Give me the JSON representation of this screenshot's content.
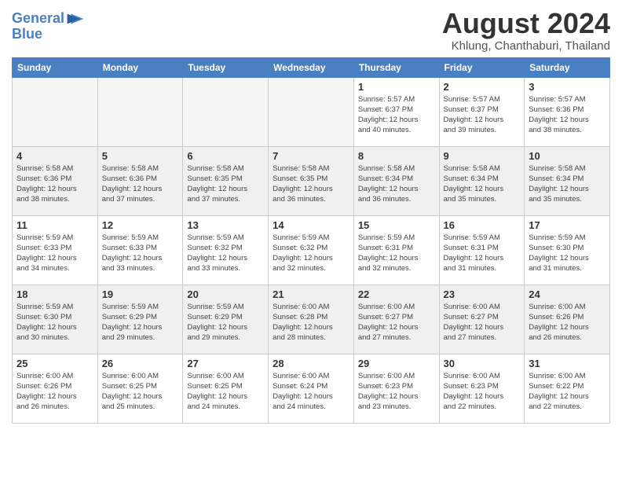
{
  "header": {
    "logo_line1": "General",
    "logo_line2": "Blue",
    "month": "August 2024",
    "location": "Khlung, Chanthaburi, Thailand"
  },
  "days_of_week": [
    "Sunday",
    "Monday",
    "Tuesday",
    "Wednesday",
    "Thursday",
    "Friday",
    "Saturday"
  ],
  "weeks": [
    [
      {
        "num": "",
        "info": "",
        "empty": true
      },
      {
        "num": "",
        "info": "",
        "empty": true
      },
      {
        "num": "",
        "info": "",
        "empty": true
      },
      {
        "num": "",
        "info": "",
        "empty": true
      },
      {
        "num": "1",
        "info": "Sunrise: 5:57 AM\nSunset: 6:37 PM\nDaylight: 12 hours\nand 40 minutes."
      },
      {
        "num": "2",
        "info": "Sunrise: 5:57 AM\nSunset: 6:37 PM\nDaylight: 12 hours\nand 39 minutes."
      },
      {
        "num": "3",
        "info": "Sunrise: 5:57 AM\nSunset: 6:36 PM\nDaylight: 12 hours\nand 38 minutes."
      }
    ],
    [
      {
        "num": "4",
        "info": "Sunrise: 5:58 AM\nSunset: 6:36 PM\nDaylight: 12 hours\nand 38 minutes.",
        "shaded": true
      },
      {
        "num": "5",
        "info": "Sunrise: 5:58 AM\nSunset: 6:36 PM\nDaylight: 12 hours\nand 37 minutes.",
        "shaded": true
      },
      {
        "num": "6",
        "info": "Sunrise: 5:58 AM\nSunset: 6:35 PM\nDaylight: 12 hours\nand 37 minutes.",
        "shaded": true
      },
      {
        "num": "7",
        "info": "Sunrise: 5:58 AM\nSunset: 6:35 PM\nDaylight: 12 hours\nand 36 minutes.",
        "shaded": true
      },
      {
        "num": "8",
        "info": "Sunrise: 5:58 AM\nSunset: 6:34 PM\nDaylight: 12 hours\nand 36 minutes.",
        "shaded": true
      },
      {
        "num": "9",
        "info": "Sunrise: 5:58 AM\nSunset: 6:34 PM\nDaylight: 12 hours\nand 35 minutes.",
        "shaded": true
      },
      {
        "num": "10",
        "info": "Sunrise: 5:58 AM\nSunset: 6:34 PM\nDaylight: 12 hours\nand 35 minutes.",
        "shaded": true
      }
    ],
    [
      {
        "num": "11",
        "info": "Sunrise: 5:59 AM\nSunset: 6:33 PM\nDaylight: 12 hours\nand 34 minutes."
      },
      {
        "num": "12",
        "info": "Sunrise: 5:59 AM\nSunset: 6:33 PM\nDaylight: 12 hours\nand 33 minutes."
      },
      {
        "num": "13",
        "info": "Sunrise: 5:59 AM\nSunset: 6:32 PM\nDaylight: 12 hours\nand 33 minutes."
      },
      {
        "num": "14",
        "info": "Sunrise: 5:59 AM\nSunset: 6:32 PM\nDaylight: 12 hours\nand 32 minutes."
      },
      {
        "num": "15",
        "info": "Sunrise: 5:59 AM\nSunset: 6:31 PM\nDaylight: 12 hours\nand 32 minutes."
      },
      {
        "num": "16",
        "info": "Sunrise: 5:59 AM\nSunset: 6:31 PM\nDaylight: 12 hours\nand 31 minutes."
      },
      {
        "num": "17",
        "info": "Sunrise: 5:59 AM\nSunset: 6:30 PM\nDaylight: 12 hours\nand 31 minutes."
      }
    ],
    [
      {
        "num": "18",
        "info": "Sunrise: 5:59 AM\nSunset: 6:30 PM\nDaylight: 12 hours\nand 30 minutes.",
        "shaded": true
      },
      {
        "num": "19",
        "info": "Sunrise: 5:59 AM\nSunset: 6:29 PM\nDaylight: 12 hours\nand 29 minutes.",
        "shaded": true
      },
      {
        "num": "20",
        "info": "Sunrise: 5:59 AM\nSunset: 6:29 PM\nDaylight: 12 hours\nand 29 minutes.",
        "shaded": true
      },
      {
        "num": "21",
        "info": "Sunrise: 6:00 AM\nSunset: 6:28 PM\nDaylight: 12 hours\nand 28 minutes.",
        "shaded": true
      },
      {
        "num": "22",
        "info": "Sunrise: 6:00 AM\nSunset: 6:27 PM\nDaylight: 12 hours\nand 27 minutes.",
        "shaded": true
      },
      {
        "num": "23",
        "info": "Sunrise: 6:00 AM\nSunset: 6:27 PM\nDaylight: 12 hours\nand 27 minutes.",
        "shaded": true
      },
      {
        "num": "24",
        "info": "Sunrise: 6:00 AM\nSunset: 6:26 PM\nDaylight: 12 hours\nand 26 minutes.",
        "shaded": true
      }
    ],
    [
      {
        "num": "25",
        "info": "Sunrise: 6:00 AM\nSunset: 6:26 PM\nDaylight: 12 hours\nand 26 minutes."
      },
      {
        "num": "26",
        "info": "Sunrise: 6:00 AM\nSunset: 6:25 PM\nDaylight: 12 hours\nand 25 minutes."
      },
      {
        "num": "27",
        "info": "Sunrise: 6:00 AM\nSunset: 6:25 PM\nDaylight: 12 hours\nand 24 minutes."
      },
      {
        "num": "28",
        "info": "Sunrise: 6:00 AM\nSunset: 6:24 PM\nDaylight: 12 hours\nand 24 minutes."
      },
      {
        "num": "29",
        "info": "Sunrise: 6:00 AM\nSunset: 6:23 PM\nDaylight: 12 hours\nand 23 minutes."
      },
      {
        "num": "30",
        "info": "Sunrise: 6:00 AM\nSunset: 6:23 PM\nDaylight: 12 hours\nand 22 minutes."
      },
      {
        "num": "31",
        "info": "Sunrise: 6:00 AM\nSunset: 6:22 PM\nDaylight: 12 hours\nand 22 minutes."
      }
    ]
  ]
}
